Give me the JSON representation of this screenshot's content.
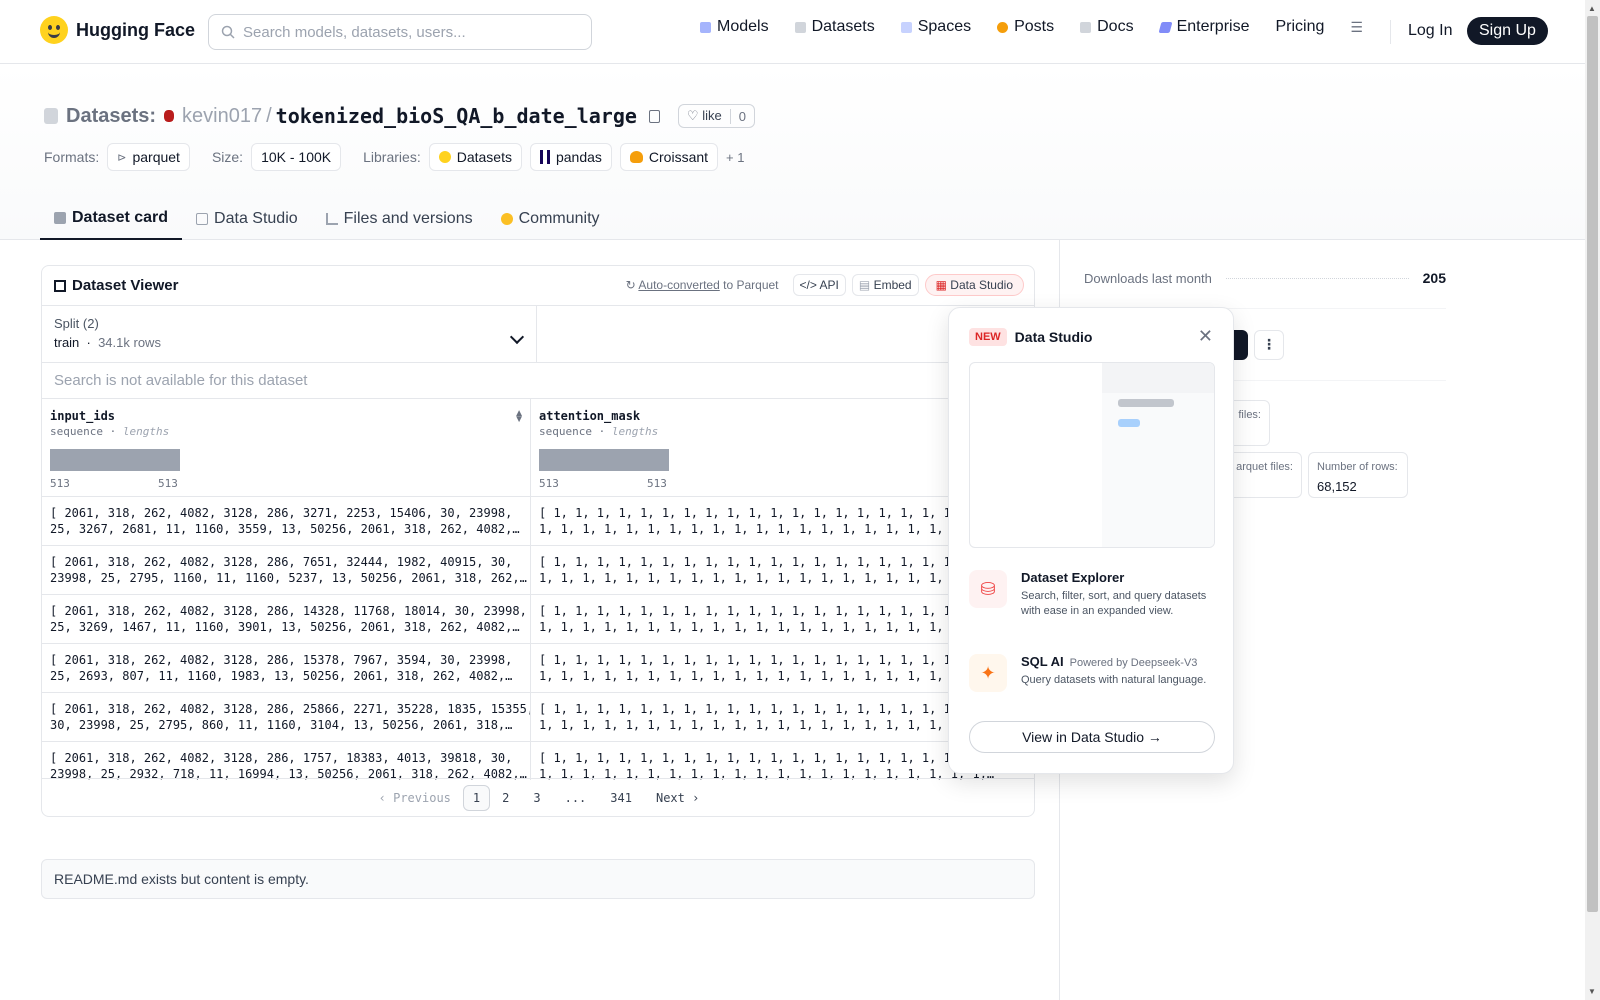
{
  "nav": {
    "brand": "Hugging Face",
    "search_placeholder": "Search models, datasets, users...",
    "links": [
      "Models",
      "Datasets",
      "Spaces",
      "Posts",
      "Docs",
      "Enterprise",
      "Pricing"
    ],
    "login": "Log In",
    "signup": "Sign Up"
  },
  "header": {
    "crumb_label": "Datasets:",
    "user": "kevin017",
    "separator": "/",
    "dataset_name": "tokenized_bioS_QA_b_date_large",
    "like_label": "like",
    "like_count": "0",
    "formats_label": "Formats:",
    "format": "parquet",
    "size_label": "Size:",
    "size": "10K - 100K",
    "libraries_label": "Libraries:",
    "libraries": [
      "Datasets",
      "pandas",
      "Croissant"
    ],
    "more_libraries": "+ 1"
  },
  "tabs": [
    "Dataset card",
    "Data Studio",
    "Files and versions",
    "Community"
  ],
  "viewer": {
    "title": "Dataset Viewer",
    "auto_converted": "Auto-converted",
    "to_parquet": "to Parquet",
    "api": "API",
    "embed": "Embed",
    "data_studio": "Data Studio",
    "split_label": "Split (2)",
    "split_name": "train",
    "split_rows": "34.1k rows",
    "search_na": "Search is not available for this dataset",
    "columns": [
      {
        "name": "input_ids",
        "type": "sequence",
        "sub": "lengths",
        "min": "513",
        "max": "513"
      },
      {
        "name": "attention_mask",
        "type": "sequence",
        "sub": "lengths",
        "min": "513",
        "max": "513"
      }
    ],
    "rows": [
      {
        "input_ids": "[ 2061, 318, 262, 4082, 3128, 286, 3271, 2253, 15406, 30, 23998,\n25, 3267, 2681, 11, 1160, 3559, 13, 50256, 2061, 318, 262, 4082,…",
        "attention_mask": "[ 1, 1, 1, 1, 1, 1, 1, 1, 1, 1, 1, 1, 1, 1, 1, 1, 1, 1, 1, 1, 1,\n1, 1, 1, 1, 1, 1, 1, 1, 1, 1, 1, 1, 1, 1, 1, 1, 1, 1, 1, 1, 1,…"
      },
      {
        "input_ids": "[ 2061, 318, 262, 4082, 3128, 286, 7651, 32444, 1982, 40915, 30,\n23998, 25, 2795, 1160, 11, 1160, 5237, 13, 50256, 2061, 318, 262,…",
        "attention_mask": "[ 1, 1, 1, 1, 1, 1, 1, 1, 1, 1, 1, 1, 1, 1, 1, 1, 1, 1, 1, 1, 1,\n1, 1, 1, 1, 1, 1, 1, 1, 1, 1, 1, 1, 1, 1, 1, 1, 1, 1, 1, 1, 1,…"
      },
      {
        "input_ids": "[ 2061, 318, 262, 4082, 3128, 286, 14328, 11768, 18014, 30, 23998,\n25, 3269, 1467, 11, 1160, 3901, 13, 50256, 2061, 318, 262, 4082,…",
        "attention_mask": "[ 1, 1, 1, 1, 1, 1, 1, 1, 1, 1, 1, 1, 1, 1, 1, 1, 1, 1, 1, 1, 1,\n1, 1, 1, 1, 1, 1, 1, 1, 1, 1, 1, 1, 1, 1, 1, 1, 1, 1, 1, 1, 1,…"
      },
      {
        "input_ids": "[ 2061, 318, 262, 4082, 3128, 286, 15378, 7967, 3594, 30, 23998,\n25, 2693, 807, 11, 1160, 1983, 13, 50256, 2061, 318, 262, 4082,…",
        "attention_mask": "[ 1, 1, 1, 1, 1, 1, 1, 1, 1, 1, 1, 1, 1, 1, 1, 1, 1, 1, 1, 1, 1,\n1, 1, 1, 1, 1, 1, 1, 1, 1, 1, 1, 1, 1, 1, 1, 1, 1, 1, 1, 1, 1,…"
      },
      {
        "input_ids": "[ 2061, 318, 262, 4082, 3128, 286, 25866, 2271, 35228, 1835, 15355,\n30, 23998, 25, 2795, 860, 11, 1160, 3104, 13, 50256, 2061, 318,…",
        "attention_mask": "[ 1, 1, 1, 1, 1, 1, 1, 1, 1, 1, 1, 1, 1, 1, 1, 1, 1, 1, 1, 1, 1,\n1, 1, 1, 1, 1, 1, 1, 1, 1, 1, 1, 1, 1, 1, 1, 1, 1, 1, 1, 1, 1,…"
      },
      {
        "input_ids": "[ 2061, 318, 262, 4082, 3128, 286, 1757, 18383, 4013, 39818, 30,\n23998, 25, 2932, 718, 11, 16994, 13, 50256, 2061, 318, 262, 4082,…",
        "attention_mask": "[ 1, 1, 1, 1, 1, 1, 1, 1, 1, 1, 1, 1, 1, 1, 1, 1, 1, 1, 1, 1, 1,\n1, 1, 1, 1, 1, 1, 1, 1, 1, 1, 1, 1, 1, 1, 1, 1, 1, 1, 1, 1, 1,…"
      }
    ],
    "pagination": {
      "previous": "Previous",
      "pages": [
        "1",
        "2",
        "3",
        "...",
        "341"
      ],
      "next": "Next"
    }
  },
  "readme_note": "README.md exists but content is empty.",
  "sidebar": {
    "downloads_label": "Downloads last month",
    "downloads_value": "205",
    "files_label_partial": "files:",
    "parquet_files_label_partial": "arquet files:",
    "rows_label": "Number of rows:",
    "rows_value": "68,152"
  },
  "popover": {
    "badge": "NEW",
    "title": "Data Studio",
    "explorer_title": "Dataset Explorer",
    "explorer_desc": "Search, filter, sort, and query datasets with ease in an expanded view.",
    "sql_title": "SQL AI",
    "sql_powered": "Powered by Deepseek-V3",
    "sql_desc": "Query datasets with natural language.",
    "cta": "View in Data Studio →"
  }
}
